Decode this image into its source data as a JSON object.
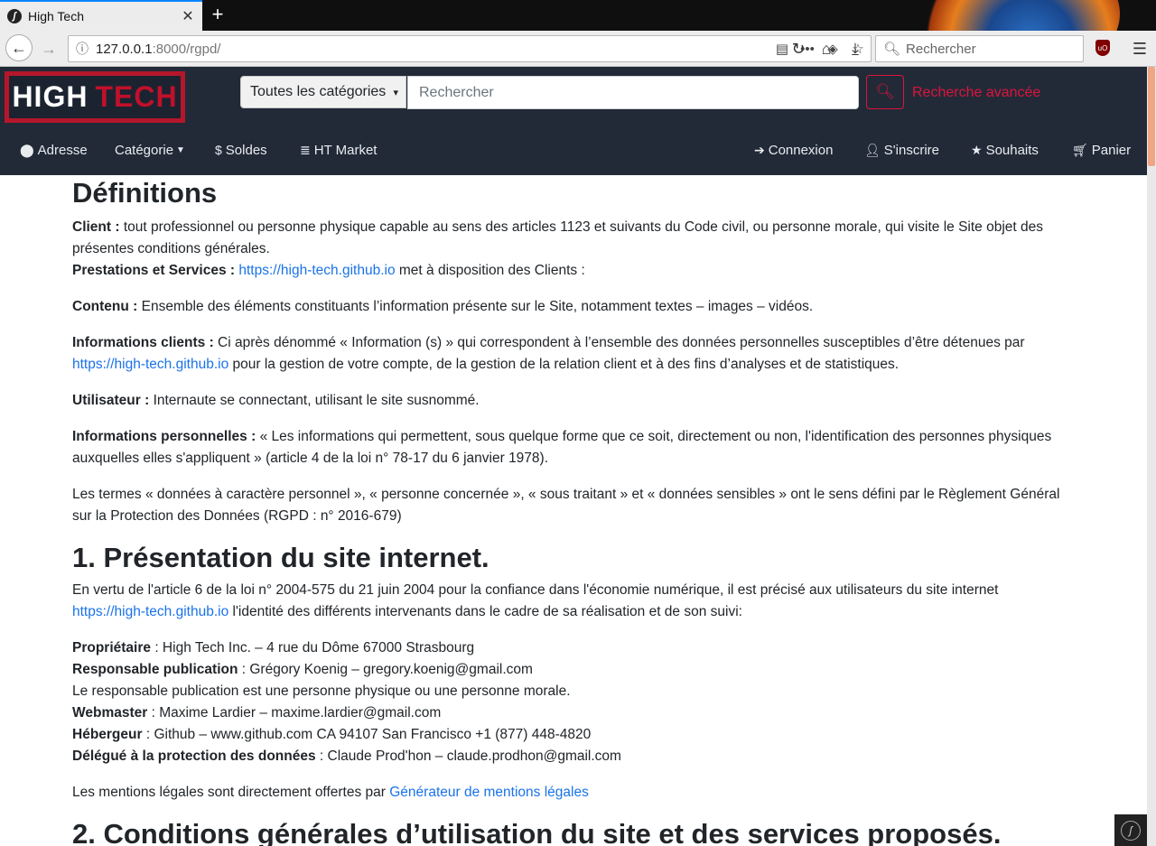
{
  "browser": {
    "tab_title": "High Tech",
    "tab_favicon": "sf",
    "url_host": "127.0.0.1",
    "url_rest": ":8000/rgpd/",
    "search_placeholder": "Rechercher"
  },
  "header": {
    "logo_part1": "HIGH",
    "logo_part2": "TECH",
    "category_select": "Toutes les catégories",
    "search_placeholder": "Rechercher",
    "advanced_search": "Recherche avancée"
  },
  "nav": {
    "left": [
      {
        "label": "Adresse",
        "icon": "map-marker-icon"
      },
      {
        "label": "Catégorie",
        "icon": "caret-down-icon"
      },
      {
        "label": "Soldes",
        "icon": "dollar-icon"
      },
      {
        "label": "HT Market",
        "icon": "coins-icon"
      }
    ],
    "right": [
      {
        "label": "Connexion",
        "icon": "sign-in-icon"
      },
      {
        "label": "S'inscrire",
        "icon": "user-plus-icon"
      },
      {
        "label": "Souhaits",
        "icon": "star-icon"
      },
      {
        "label": "Panier",
        "icon": "cart-icon"
      }
    ]
  },
  "content": {
    "h_definitions": "Définitions",
    "client_label": "Client :",
    "client_text": " tout professionnel ou personne physique capable au sens des articles 1123 et suivants du Code civil, ou personne morale, qui visite le Site objet des présentes conditions générales.",
    "prestations_label": "Prestations et Services :",
    "site_link": "https://high-tech.github.io",
    "prestations_text": " met à disposition des Clients :",
    "contenu_label": "Contenu :",
    "contenu_text": " Ensemble des éléments constituants l’information présente sur le Site, notamment textes – images – vidéos.",
    "infoclients_label": "Informations clients :",
    "infoclients_text": " Ci après dénommé « Information (s) » qui correspondent à l’ensemble des données personnelles susceptibles d’être détenues par ",
    "infoclients_text2": " pour la gestion de votre compte, de la gestion de la relation client et à des fins d’analyses et de statistiques.",
    "utilisateur_label": "Utilisateur :",
    "utilisateur_text": " Internaute se connectant, utilisant le site susnommé.",
    "infoperso_label": "Informations personnelles :",
    "infoperso_text": " « Les informations qui permettent, sous quelque forme que ce soit, directement ou non, l'identification des personnes physiques auxquelles elles s'appliquent » (article 4 de la loi n° 78-17 du 6 janvier 1978).",
    "termes_text": "Les termes « données à caractère personnel », « personne concernée », « sous traitant » et « données sensibles » ont le sens défini par le Règlement Général sur la Protection des Données (RGPD : n° 2016-679)",
    "h_presentation": "1. Présentation du site internet.",
    "presentation_text": "En vertu de l'article 6 de la loi n° 2004-575 du 21 juin 2004 pour la confiance dans l'économie numérique, il est précisé aux utilisateurs du site internet ",
    "presentation_text2": " l'identité des différents intervenants dans le cadre de sa réalisation et de son suivi:",
    "proprietaire_label": "Propriétaire",
    "proprietaire_text": " : High Tech Inc. – 4 rue du Dôme 67000 Strasbourg",
    "responsable_label": "Responsable publication",
    "responsable_text": " : Grégory Koenig – gregory.koenig@gmail.com",
    "responsable_note": "Le responsable publication est une personne physique ou une personne morale.",
    "webmaster_label": "Webmaster",
    "webmaster_text": " : Maxime Lardier – maxime.lardier@gmail.com",
    "hebergeur_label": "Hébergeur",
    "hebergeur_text": " : Github – www.github.com CA 94107 San Francisco +1 (877) 448-4820",
    "delegue_label": "Délégué à la protection des données",
    "delegue_text": " : Claude Prod'hon – claude.prodhon@gmail.com",
    "mentions_text": "Les mentions légales sont directement offertes par ",
    "mentions_link": "Générateur de mentions légales",
    "h_conditions": "2. Conditions générales d’utilisation du site et des services proposés."
  }
}
